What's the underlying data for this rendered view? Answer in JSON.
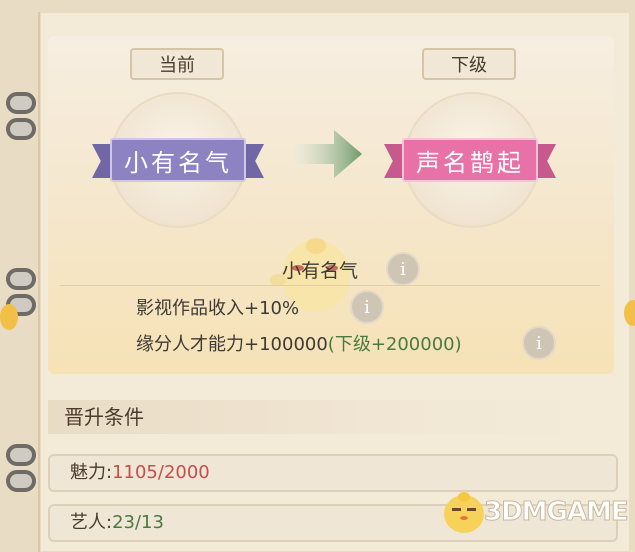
{
  "rank": {
    "current_label": "当前",
    "next_label": "下级",
    "current_name": "小有名气",
    "next_name": "声名鹊起"
  },
  "details": {
    "title": "小有名气",
    "line1": "影视作品收入+10%",
    "line2_main": "缘分人才能力+100000",
    "line2_next": "(下级+200000)"
  },
  "conditions": {
    "heading": "晋升条件",
    "charm_label": "魅力:",
    "charm_value": "1105/2000",
    "artist_label": "艺人:",
    "artist_value": "23/13"
  },
  "watermark": "3DMGAME",
  "colors": {
    "current_ribbon": "#8e83c2",
    "next_ribbon": "#e872a7",
    "unmet_value": "#c0504d",
    "met_value": "#4a7a42",
    "next_bonus": "#4a7a42"
  }
}
